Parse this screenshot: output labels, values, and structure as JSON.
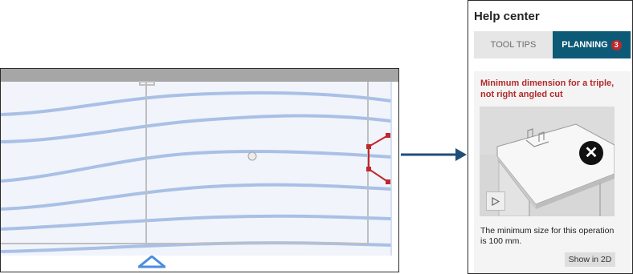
{
  "help_center": {
    "title": "Help center",
    "tabs": [
      {
        "label": "TOOL TIPS",
        "active": false
      },
      {
        "label": "PLANNING",
        "active": true,
        "badge": "3"
      }
    ],
    "card": {
      "title": "Minimum dimension for a triple, not right angled cut",
      "description": "The minimum size for this operation is 100 mm.",
      "show_button_label": "Show in 2D",
      "close_icon": "close-icon",
      "play_icon": "play-icon"
    }
  },
  "colors": {
    "accent": "#0d5a76",
    "badge": "#c0272d",
    "warning_title": "#b22a2a",
    "grain": "#a9c0e6",
    "cut_marker": "#c0272d",
    "panel_bg": "#f1f4fb"
  }
}
